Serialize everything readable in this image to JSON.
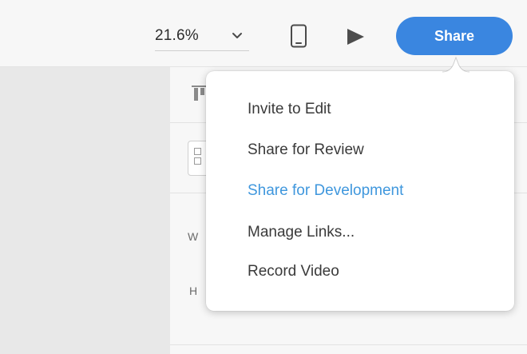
{
  "toolbar": {
    "zoom_value": "21.6%",
    "zoom_icon": "chevron-down-icon",
    "device_icon": "mobile-device-icon",
    "play_icon": "play-icon",
    "share_label": "Share"
  },
  "inspector": {
    "width_label": "W",
    "height_label": "H"
  },
  "share_menu": {
    "items": [
      {
        "label": "Invite to Edit"
      },
      {
        "label": "Share for Review"
      },
      {
        "label": "Share for Development",
        "state": "hovered"
      },
      {
        "label": "Manage Links..."
      },
      {
        "label": "Record Video"
      }
    ]
  },
  "colors": {
    "accent": "#3a86e0",
    "hover_text": "#3f97dd",
    "menu_text": "#3a3a3a",
    "canvas_bg": "#e8e8e8",
    "panel_bg": "#f7f7f7"
  }
}
